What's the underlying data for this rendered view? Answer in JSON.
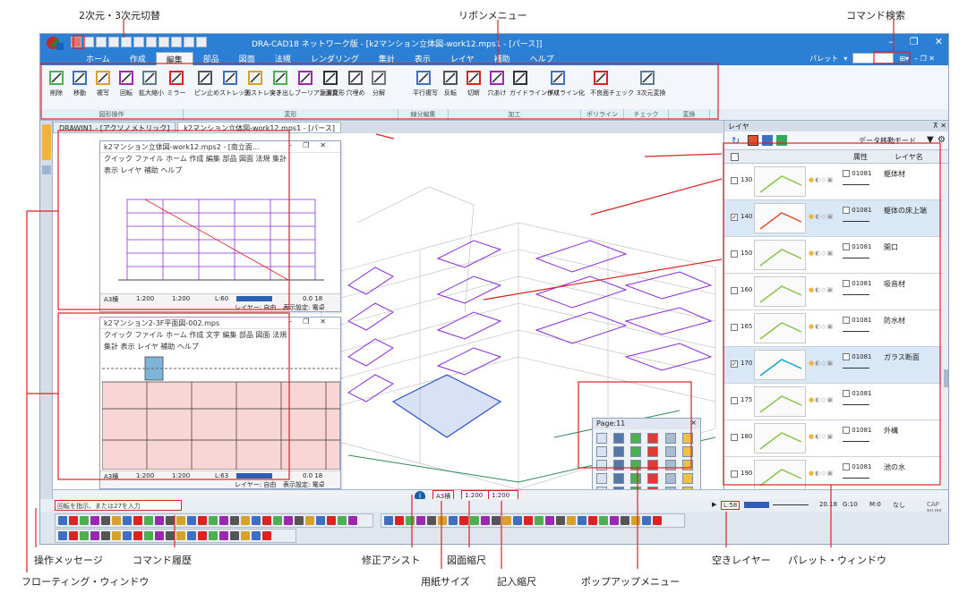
{
  "callouts": {
    "top": {
      "dimension_switch": "2次元・3次元切替",
      "ribbon_menu": "リボンメニュー",
      "command_search": "コマンド検索"
    },
    "bottom": {
      "operation_message": "操作メッセージ",
      "command_history": "コマンド履歴",
      "floating_window": "フローティング・ウィンドウ",
      "correction_assist": "修正アシスト",
      "paper_size": "用紙サイズ",
      "drawing_scale": "図面縮尺",
      "entry_scale": "記入縮尺",
      "popup_menu": "ポップアップメニュー",
      "empty_layer": "空きレイヤー",
      "palette_window": "パレット・ウィンドウ"
    }
  },
  "app": {
    "title": "DRA-CAD18 ネットワーク版 - [k2マンション立体図-work12.mps1 - [パース]]",
    "menu": [
      "ホーム",
      "作成",
      "編集",
      "部品",
      "図面",
      "法規",
      "レンダリング",
      "集計",
      "表示",
      "レイヤ",
      "補助",
      "ヘルプ"
    ],
    "active_menu": "編集",
    "palette_label": "パレット",
    "ribbon_buttons": [
      "削除",
      "移動",
      "複写",
      "回転",
      "拡大縮小",
      "ミラー",
      "ピン止め",
      "ストレッチ",
      "図ストレッチ",
      "突き出し",
      "ブーリアン演算",
      "面面変形",
      "穴埋め",
      "分解",
      "平行複写",
      "反転",
      "切断",
      "穴あけ",
      "ガイドライン作成",
      "ポリライン化",
      "不良面チェック",
      "3次元変換"
    ],
    "ribbon_groups": [
      "図形操作",
      "変形",
      "線分編集",
      "加工",
      "ポリライン",
      "チェック",
      "変換"
    ],
    "tabs": [
      "DRAWIN1 - [アクソノメトリック]",
      "k2マンション立体図-work12.mps1 - [パース]"
    ]
  },
  "subwin1": {
    "title": "k2マンション立体図-work12.mps2 - [南立面...",
    "menu1": "クイック ファイル ホーム 作成 編集 部品 図面 法規 集計",
    "menu2": "表示 レイヤ 補助 ヘルプ",
    "paper": "A3横",
    "scale1": "1:200",
    "scale2": "1:200",
    "layer": "L:60",
    "coord": "0.0 18",
    "status_a": "レイヤー: 自由",
    "status_b": "表示設定: 電卓"
  },
  "subwin2": {
    "title": "k2マンション2-3F平面図-002.mps",
    "menu1": "クイック ファイル ホーム 作成 文字 編集 部品 図面 法規",
    "menu2": "集計 表示 レイヤ 補助 ヘルプ",
    "paper": "A3横",
    "scale1": "1:200",
    "scale2": "1:200",
    "layer": "L:63",
    "coord": "0.0 18",
    "status_a": "レイヤー: 自由",
    "status_b": "表示設定: 電卓"
  },
  "popup": {
    "title": "Page:11",
    "close": "×"
  },
  "layers": {
    "title": "レイヤ",
    "mode": "データ移動モード",
    "col_attr": "属性",
    "col_name": "レイヤ名",
    "rows": [
      {
        "no": "130",
        "attr": "01081",
        "name": "躯体材",
        "checked": false,
        "selected": false
      },
      {
        "no": "140",
        "attr": "01081",
        "name": "躯体の床上端",
        "checked": true,
        "selected": true
      },
      {
        "no": "150",
        "attr": "01081",
        "name": "開口",
        "checked": false,
        "selected": false
      },
      {
        "no": "160",
        "attr": "01081",
        "name": "吸音材",
        "checked": false,
        "selected": false
      },
      {
        "no": "165",
        "attr": "01081",
        "name": "防水材",
        "checked": false,
        "selected": false
      },
      {
        "no": "170",
        "attr": "01081",
        "name": "ガラス断面",
        "checked": true,
        "selected": true
      },
      {
        "no": "175",
        "attr": "01081",
        "name": "",
        "checked": false,
        "selected": false
      },
      {
        "no": "180",
        "attr": "01081",
        "name": "外構",
        "checked": false,
        "selected": false
      },
      {
        "no": "190",
        "attr": "01081",
        "name": "池の水",
        "checked": false,
        "selected": false
      }
    ],
    "bottom_tabs": [
      "ドキ..",
      "レイヤ",
      "属..",
      "プロ..",
      "テキ..",
      "パーツ",
      "クリ.."
    ]
  },
  "status": {
    "message": "回転を指示、または27を入力",
    "paper": "A3横",
    "drawing_scale": "1:200",
    "entry_scale": "1:200",
    "layer": "L:58",
    "coord": "20.18",
    "gap": "G:10",
    "mode1": "M:0",
    "mode2": "なし",
    "layer_free": "レイヤー: 自由",
    "display": "表示設定: 電卓",
    "caps": "CAP NUM"
  }
}
